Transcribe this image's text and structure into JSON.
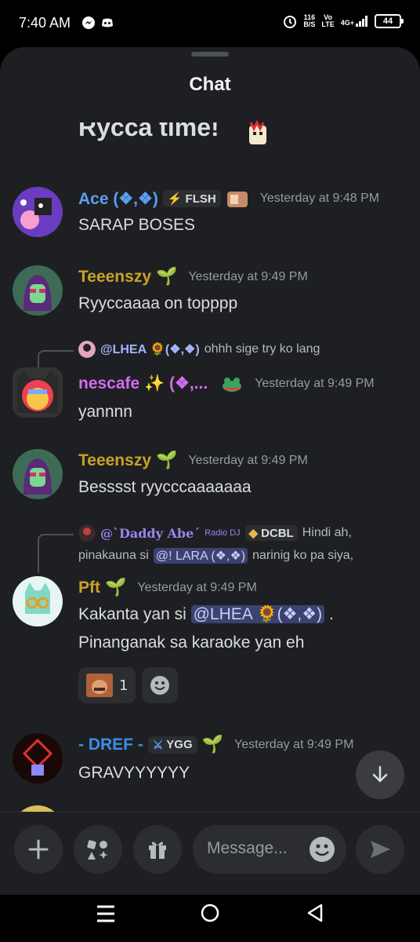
{
  "status_bar": {
    "time": "7:40 AM",
    "net_speed_top": "116",
    "net_speed_bottom": "B/S",
    "volte_top": "Vo",
    "volte_bottom": "LTE",
    "network": "4G+",
    "battery": "44"
  },
  "header": {
    "title": "Chat"
  },
  "partial_message": {
    "text": "Rycca time!"
  },
  "messages": [
    {
      "username": "Ace (❖,❖)",
      "tag": "FLSH",
      "timestamp": "Yesterday at 9:48 PM",
      "text": "SARAP BOSES",
      "name_color": "#5aa0f0"
    },
    {
      "username": "Teeenszy",
      "badge": "🌱",
      "timestamp": "Yesterday at 9:49 PM",
      "text": "Ryyccaaaa on topppp",
      "name_color": "#c9a227"
    },
    {
      "reply": {
        "name": "@LHEA 🌻(❖,❖)",
        "text": "ohhh sige try ko lang"
      },
      "username": "nescafe ✨ (❖,...",
      "timestamp": "Yesterday at 9:49 PM",
      "text": "yannnn",
      "name_color": "#d46cf0"
    },
    {
      "username": "Teeenszy",
      "badge": "🌱",
      "timestamp": "Yesterday at 9:49 PM",
      "text": "Besssst ryycccaaaaaaa",
      "name_color": "#c9a227"
    },
    {
      "reply": {
        "name": "@`Daddy Abe´",
        "role": "Radio DJ",
        "tag": "DCBL",
        "text": "Hindi ah,",
        "line2_pre": "pinakauna si",
        "mention": "@! LARA (❖,❖)",
        "line2_post": "narinig ko pa siya,"
      },
      "username": "Pft",
      "badge": "🌱",
      "timestamp": "Yesterday at 9:49 PM",
      "text_pre": "Kakanta yan si",
      "mention": "@LHEA 🌻(❖,❖)",
      "text_post": ".",
      "text_line2": "Pinanganak sa karaoke yan eh",
      "reaction_count": "1",
      "name_color": "#c9a227"
    },
    {
      "username": "- DREF -",
      "tag": "YGG",
      "badge": "🌱",
      "timestamp": "Yesterday at 9:49 PM",
      "text": "GRAVYYYYYY",
      "name_color": "#3b8ee8"
    }
  ],
  "composer": {
    "placeholder": "Message..."
  },
  "icons": [
    "messenger-icon",
    "discord-icon",
    "alarm-icon",
    "signal-icon",
    "plus-icon",
    "apps-icon",
    "gift-icon",
    "emoji-icon",
    "send-icon",
    "arrow-down-icon",
    "menu-icon",
    "home-icon",
    "back-icon"
  ]
}
